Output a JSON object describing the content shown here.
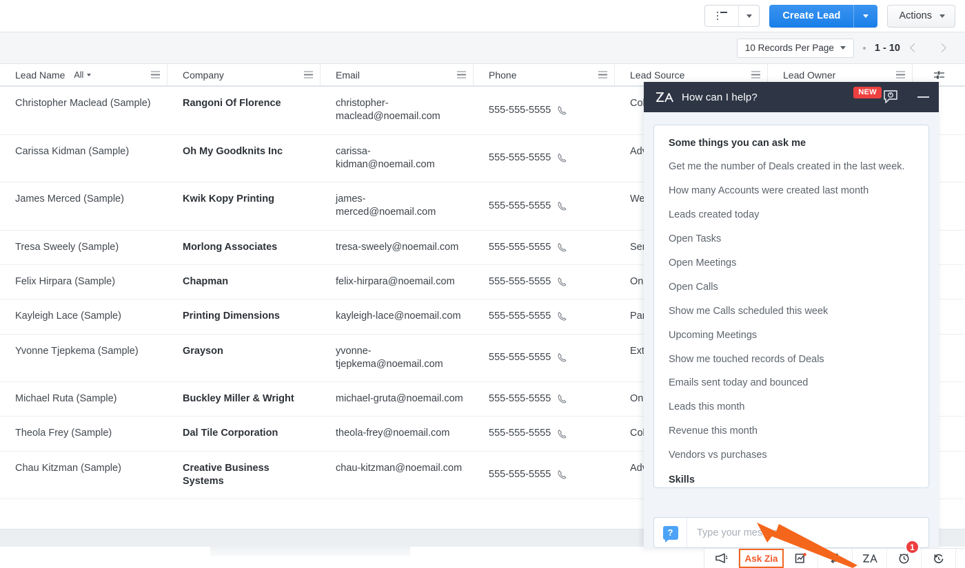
{
  "toolbar": {
    "view_icon": "list-view-icon",
    "view_dropdown_icon": "chevron-down-icon",
    "create_label": "Create Lead",
    "create_dropdown_icon": "chevron-down-icon",
    "actions_label": "Actions",
    "actions_dropdown_icon": "chevron-down-icon",
    "brand_blue": "#1a7ee8"
  },
  "pagination": {
    "records_per_page": "10 Records Per Page",
    "records_dropdown_icon": "chevron-down-icon",
    "range": "1 - 10",
    "prev_icon": "chevron-left-icon",
    "next_icon": "chevron-right-icon"
  },
  "table": {
    "columns": [
      {
        "label": "Lead Name",
        "filter": "All"
      },
      {
        "label": "Company"
      },
      {
        "label": "Email"
      },
      {
        "label": "Phone"
      },
      {
        "label": "Lead Source"
      },
      {
        "label": "Lead Owner"
      }
    ],
    "column_menu_icon": "hamburger-menu-icon",
    "settings_icon": "column-settings-icon",
    "rows": [
      {
        "name": "Christopher Maclead (Sample)",
        "company": "Rangoni Of Florence",
        "email": "christopher-maclead@noemail.com",
        "phone": "555-555-5555",
        "source": "Col",
        "owner": ""
      },
      {
        "name": "Carissa Kidman (Sample)",
        "company": "Oh My Goodknits Inc",
        "email": "carissa-kidman@noemail.com",
        "phone": "555-555-5555",
        "source": "Adv",
        "owner": ""
      },
      {
        "name": "James Merced (Sample)",
        "company": "Kwik Kopy Printing",
        "email": "james-merced@noemail.com",
        "phone": "555-555-5555",
        "source": "We",
        "owner": ""
      },
      {
        "name": "Tresa Sweely (Sample)",
        "company": "Morlong Associates",
        "email": "tresa-sweely@noemail.com",
        "phone": "555-555-5555",
        "source": "Ser",
        "owner": ""
      },
      {
        "name": "Felix Hirpara (Sample)",
        "company": "Chapman",
        "email": "felix-hirpara@noemail.com",
        "phone": "555-555-5555",
        "source": "On",
        "owner": ""
      },
      {
        "name": "Kayleigh Lace (Sample)",
        "company": "Printing Dimensions",
        "email": "kayleigh-lace@noemail.com",
        "phone": "555-555-5555",
        "source": "Par",
        "owner": ""
      },
      {
        "name": "Yvonne Tjepkema (Sample)",
        "company": "Grayson",
        "email": "yvonne-tjepkema@noemail.com",
        "phone": "555-555-5555",
        "source": "Ext",
        "owner": ""
      },
      {
        "name": "Michael Ruta (Sample)",
        "company": "Buckley Miller & Wright",
        "email": "michael-gruta@noemail.com",
        "phone": "555-555-5555",
        "source": "On",
        "owner": ""
      },
      {
        "name": "Theola Frey (Sample)",
        "company": "Dal Tile Corporation",
        "email": "theola-frey@noemail.com",
        "phone": "555-555-5555",
        "source": "Col",
        "owner": ""
      },
      {
        "name": "Chau Kitzman (Sample)",
        "company": "Creative Business Systems",
        "email": "chau-kitzman@noemail.com",
        "phone": "555-555-5555",
        "source": "Adv",
        "owner": ""
      }
    ],
    "phone_icon": "phone-call-icon"
  },
  "zia_panel": {
    "logo_icon": "zia-logo-icon",
    "title": "How can I help?",
    "new_badge": "NEW",
    "history_icon": "chat-history-icon",
    "minimize_icon": "minimize-icon",
    "suggestions_heading": "Some things you can ask me",
    "suggestions": [
      "Get me the number of Deals created in the last week.",
      "How many Accounts were created last month",
      "Leads created today",
      "Open Tasks",
      "Open Meetings",
      "Open Calls",
      "Show me Calls scheduled this week",
      "Upcoming Meetings",
      "Show me touched records of Deals",
      "Emails sent today and bounced",
      "Leads this month",
      "Revenue this month",
      "Vendors vs purchases"
    ],
    "skills_label": "Skills",
    "help_icon": "question-bubble-icon",
    "input_placeholder": "Type your message...",
    "input_value": "",
    "header_color": "#2e3645",
    "badge_color": "#ed4040"
  },
  "utility_bar": {
    "items": [
      {
        "icon": "megaphone-icon",
        "label": ""
      },
      {
        "icon": "ask-zia-icon",
        "label": "Ask Zia"
      },
      {
        "icon": "analytics-icon",
        "label": ""
      },
      {
        "icon": "signals-icon",
        "label": ""
      },
      {
        "icon": "zia-icon",
        "label": ""
      },
      {
        "icon": "alarm-clock-icon",
        "label": "",
        "badge": "1"
      },
      {
        "icon": "history-icon",
        "label": ""
      },
      {
        "icon": "recycle-bin-icon",
        "label": ""
      }
    ],
    "highlight_color": "#f26522",
    "badge_color": "#ec3f3f"
  },
  "annotation": {
    "arrow_icon": "pointer-arrow-icon",
    "color": "#f4661b"
  }
}
